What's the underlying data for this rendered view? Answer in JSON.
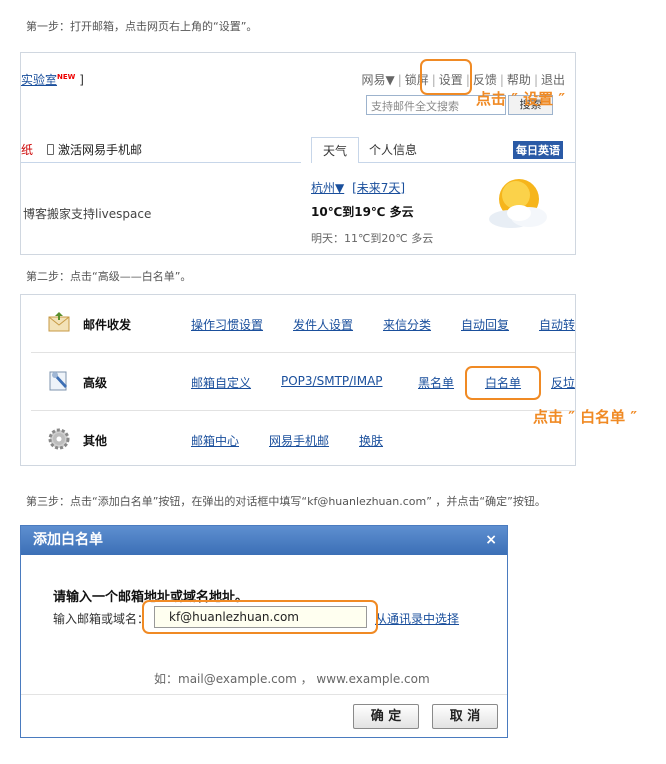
{
  "steps": {
    "step1": "第一步：打开邮箱，点击网页右上角的“设置”。",
    "step2": "第二步：点击“高级——白名单”。",
    "step3": "第三步：点击“添加白名单”按钮，在弹出的对话框中填写“kf@huanlezhuan.com” ，并点击“确定”按钮。"
  },
  "shot1": {
    "lab_text": "实验室",
    "lab_badge": "NEW",
    "lab_bracket": "]",
    "nav": [
      "网易▼",
      "锁屏",
      "设置",
      "反馈",
      "帮助",
      "退出"
    ],
    "search_placeholder": "支持邮件全文搜索",
    "search_button": "搜索",
    "callout": "点击 ″ 设置 ″",
    "red_part": "纸",
    "phone_link": "激活网易手机邮",
    "tab_weather": "天气",
    "tab_personal": "个人信息",
    "daily_english": "每日英语",
    "blog_text": "博客搬家支持livespace",
    "city": "杭州▼",
    "forecast_link": "[未来7天]",
    "temp_today": "10℃到19℃ 多云",
    "temp_tomorrow": "明天：11℃到20℃ 多云"
  },
  "shot2": {
    "rows": [
      {
        "title": "邮件收发",
        "icon": "mail-send-icon",
        "links": [
          "操作习惯设置",
          "发件人设置",
          "来信分类",
          "自动回复",
          "自动转"
        ]
      },
      {
        "title": "高级",
        "icon": "advanced-tools-icon",
        "links": [
          "邮箱自定义",
          "POP3/SMTP/IMAP",
          "黑名单",
          "白名单",
          "反垃"
        ]
      },
      {
        "title": "其他",
        "icon": "gear-icon",
        "links": [
          "邮箱中心",
          "网易手机邮",
          "换肤"
        ]
      }
    ],
    "callout": "点击 ″ 白名单 ″"
  },
  "shot3": {
    "title": "添加白名单",
    "close": "×",
    "question": "请输入一个邮箱地址或域名地址。",
    "label": "输入邮箱或域名：",
    "input_value": "kf@huanlezhuan.com",
    "address_link": "从通讯录中选择",
    "example": "如：mail@example.com ， www.example.com",
    "ok": "确 定",
    "cancel": "取 消"
  },
  "colors": {
    "accent_orange": "#f08a24",
    "link_blue": "#1a4f9c",
    "dialog_header": "#3b6fb6"
  }
}
